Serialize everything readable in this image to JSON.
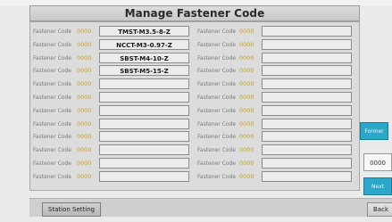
{
  "title": "Manage Fastener Code",
  "left_rows": [
    {
      "label": "Fastener Code",
      "num": "0000",
      "value": "TMST-M3.5-8-Z"
    },
    {
      "label": "Fastener Code",
      "num": "0000",
      "value": "NCCT-M3-0.97-Z"
    },
    {
      "label": "Fastener Code",
      "num": "0000",
      "value": "SBST-M4-10-Z"
    },
    {
      "label": "Fastener Code",
      "num": "0000",
      "value": "SBST-M5-15-Z"
    },
    {
      "label": "Fastener Code",
      "num": "0000",
      "value": ""
    },
    {
      "label": "Fastener Code",
      "num": "0000",
      "value": ""
    },
    {
      "label": "Fastener Code",
      "num": "0000",
      "value": ""
    },
    {
      "label": "Fastener Code",
      "num": "0000",
      "value": ""
    },
    {
      "label": "Fastener Code",
      "num": "0000",
      "value": ""
    },
    {
      "label": "Fastener Code",
      "num": "0000",
      "value": ""
    },
    {
      "label": "Fastener Code",
      "num": "0000",
      "value": ""
    },
    {
      "label": "Fastener Code",
      "num": "0000",
      "value": ""
    }
  ],
  "right_rows": [
    {
      "label": "Fastener Code",
      "num": "0000",
      "value": ""
    },
    {
      "label": "Fastener Code",
      "num": "0000",
      "value": ""
    },
    {
      "label": "Fastener Code",
      "num": "0000",
      "value": ""
    },
    {
      "label": "Fastener Code",
      "num": "0000",
      "value": ""
    },
    {
      "label": "Fastener Code",
      "num": "0000",
      "value": ""
    },
    {
      "label": "Fastener Code",
      "num": "0000",
      "value": ""
    },
    {
      "label": "Fastener Code",
      "num": "0000",
      "value": ""
    },
    {
      "label": "Fastener Code",
      "num": "0000",
      "value": ""
    },
    {
      "label": "Fastener Code",
      "num": "0000",
      "value": ""
    },
    {
      "label": "Fastener Code",
      "num": "0000",
      "value": ""
    },
    {
      "label": "Fastener Code",
      "num": "0000",
      "value": ""
    },
    {
      "label": "Fastener Code",
      "num": "0000",
      "value": ""
    }
  ],
  "side": {
    "former_label": "Former",
    "page_value": "0000",
    "next_label": "Next"
  },
  "footer": {
    "station_label": "Station Setting",
    "back_label": "Back"
  },
  "colors": {
    "accent": "#2aa7c9",
    "code_number": "#c8a020"
  }
}
